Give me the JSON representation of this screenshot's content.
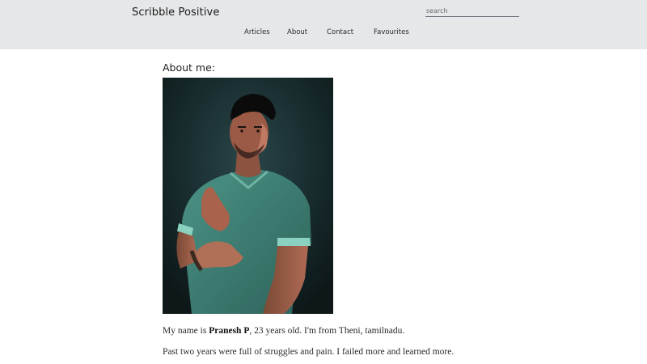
{
  "header": {
    "brand": "Scribble Positive",
    "search_placeholder": "search",
    "nav": [
      "Articles",
      "About",
      "Contact",
      "Favourites"
    ]
  },
  "main": {
    "title": "About me:",
    "photo": "portrait of a man in a teal t-shirt, hand gesture, dark background",
    "paragraphs": {
      "p1": {
        "prefix": "My name is ",
        "name": "Pranesh P",
        "suffix": ", 23 years old. I'm from Theni, tamilnadu."
      },
      "p2": "Past two years were full of struggles and pain. I failed more and learned more."
    }
  },
  "colors": {
    "header_bg": "#e6e7e9",
    "page_bg": "#ffffff",
    "text": "#222222",
    "photo_bg": "#132123",
    "shirt": "#3f7f74"
  }
}
